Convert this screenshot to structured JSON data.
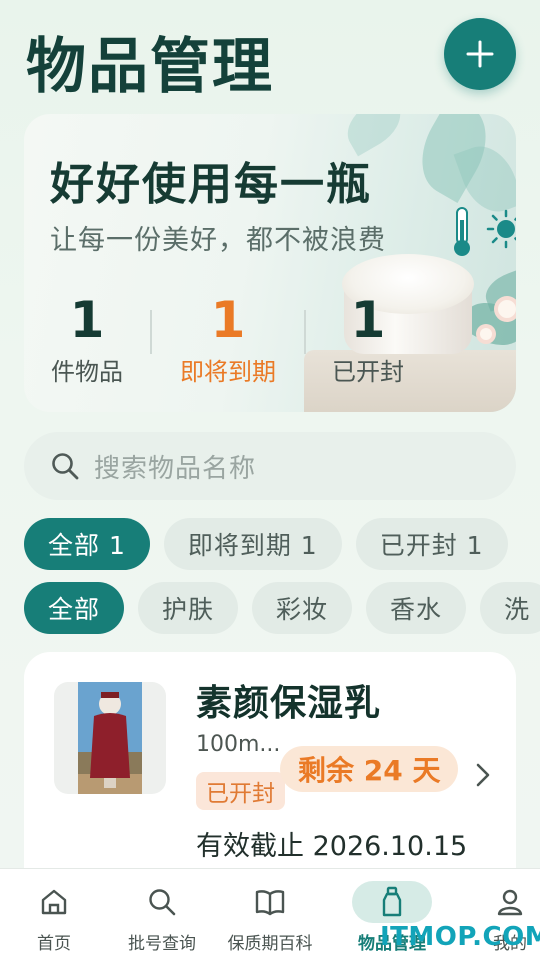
{
  "page": {
    "title": "物品管理"
  },
  "banner": {
    "title": "好好使用每一瓶",
    "subtitle": "让每一份美好，都不被浪费",
    "stats": [
      {
        "value": "1",
        "label": "件物品",
        "color": "#153b33"
      },
      {
        "value": "1",
        "label": "即将到期",
        "color": "#ea7a26"
      },
      {
        "value": "1",
        "label": "已开封",
        "color": "#153b33"
      }
    ]
  },
  "search": {
    "placeholder": "搜索物品名称"
  },
  "status_filters": [
    {
      "label": "全部 1",
      "active": true
    },
    {
      "label": "即将到期 1",
      "active": false
    },
    {
      "label": "已开封 1",
      "active": false
    }
  ],
  "category_filters": [
    {
      "label": "全部",
      "active": true
    },
    {
      "label": "护肤",
      "active": false
    },
    {
      "label": "彩妆",
      "active": false
    },
    {
      "label": "香水",
      "active": false
    },
    {
      "label": "洗",
      "active": false
    }
  ],
  "item": {
    "name": "素颜保湿乳",
    "size": "100m...",
    "remaining": "剩余 24 天",
    "status": "已开封",
    "expiry": "有效截止 2026.10.15"
  },
  "tabbar": [
    {
      "label": "首页",
      "icon": "home-icon",
      "active": false
    },
    {
      "label": "批号查询",
      "icon": "search-icon",
      "active": false
    },
    {
      "label": "保质期百科",
      "icon": "book-icon",
      "active": false
    },
    {
      "label": "物品管理",
      "icon": "bottle-icon",
      "active": true
    },
    {
      "label": "我的",
      "icon": "user-icon",
      "active": false
    }
  ],
  "watermark": "ITMOP.COM",
  "colors": {
    "accent": "#177e78",
    "warning": "#ea7a26"
  }
}
